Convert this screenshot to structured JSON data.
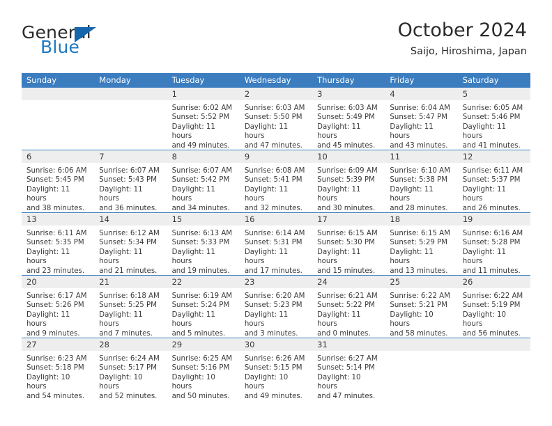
{
  "brand": {
    "name_top": "General",
    "name_bottom": "Blue",
    "triangle_icon": "triangle-icon",
    "color_top": "#2b2b2b",
    "color_bottom": "#1f79c0",
    "triangle_color": "#1566ad"
  },
  "header": {
    "title": "October 2024",
    "subtitle": "Saijo, Hiroshima, Japan"
  },
  "theme": {
    "header_band": "#3b7dbf",
    "date_band": "#eeeeee",
    "text": "#3a3a3a"
  },
  "weekdays": [
    "Sunday",
    "Monday",
    "Tuesday",
    "Wednesday",
    "Thursday",
    "Friday",
    "Saturday"
  ],
  "weeks": [
    [
      {
        "day": "",
        "info": ""
      },
      {
        "day": "",
        "info": ""
      },
      {
        "day": "1",
        "info": "Sunrise: 6:02 AM\nSunset: 5:52 PM\nDaylight: 11 hours\nand 49 minutes."
      },
      {
        "day": "2",
        "info": "Sunrise: 6:03 AM\nSunset: 5:50 PM\nDaylight: 11 hours\nand 47 minutes."
      },
      {
        "day": "3",
        "info": "Sunrise: 6:03 AM\nSunset: 5:49 PM\nDaylight: 11 hours\nand 45 minutes."
      },
      {
        "day": "4",
        "info": "Sunrise: 6:04 AM\nSunset: 5:47 PM\nDaylight: 11 hours\nand 43 minutes."
      },
      {
        "day": "5",
        "info": "Sunrise: 6:05 AM\nSunset: 5:46 PM\nDaylight: 11 hours\nand 41 minutes."
      }
    ],
    [
      {
        "day": "6",
        "info": "Sunrise: 6:06 AM\nSunset: 5:45 PM\nDaylight: 11 hours\nand 38 minutes."
      },
      {
        "day": "7",
        "info": "Sunrise: 6:07 AM\nSunset: 5:43 PM\nDaylight: 11 hours\nand 36 minutes."
      },
      {
        "day": "8",
        "info": "Sunrise: 6:07 AM\nSunset: 5:42 PM\nDaylight: 11 hours\nand 34 minutes."
      },
      {
        "day": "9",
        "info": "Sunrise: 6:08 AM\nSunset: 5:41 PM\nDaylight: 11 hours\nand 32 minutes."
      },
      {
        "day": "10",
        "info": "Sunrise: 6:09 AM\nSunset: 5:39 PM\nDaylight: 11 hours\nand 30 minutes."
      },
      {
        "day": "11",
        "info": "Sunrise: 6:10 AM\nSunset: 5:38 PM\nDaylight: 11 hours\nand 28 minutes."
      },
      {
        "day": "12",
        "info": "Sunrise: 6:11 AM\nSunset: 5:37 PM\nDaylight: 11 hours\nand 26 minutes."
      }
    ],
    [
      {
        "day": "13",
        "info": "Sunrise: 6:11 AM\nSunset: 5:35 PM\nDaylight: 11 hours\nand 23 minutes."
      },
      {
        "day": "14",
        "info": "Sunrise: 6:12 AM\nSunset: 5:34 PM\nDaylight: 11 hours\nand 21 minutes."
      },
      {
        "day": "15",
        "info": "Sunrise: 6:13 AM\nSunset: 5:33 PM\nDaylight: 11 hours\nand 19 minutes."
      },
      {
        "day": "16",
        "info": "Sunrise: 6:14 AM\nSunset: 5:31 PM\nDaylight: 11 hours\nand 17 minutes."
      },
      {
        "day": "17",
        "info": "Sunrise: 6:15 AM\nSunset: 5:30 PM\nDaylight: 11 hours\nand 15 minutes."
      },
      {
        "day": "18",
        "info": "Sunrise: 6:15 AM\nSunset: 5:29 PM\nDaylight: 11 hours\nand 13 minutes."
      },
      {
        "day": "19",
        "info": "Sunrise: 6:16 AM\nSunset: 5:28 PM\nDaylight: 11 hours\nand 11 minutes."
      }
    ],
    [
      {
        "day": "20",
        "info": "Sunrise: 6:17 AM\nSunset: 5:26 PM\nDaylight: 11 hours\nand 9 minutes."
      },
      {
        "day": "21",
        "info": "Sunrise: 6:18 AM\nSunset: 5:25 PM\nDaylight: 11 hours\nand 7 minutes."
      },
      {
        "day": "22",
        "info": "Sunrise: 6:19 AM\nSunset: 5:24 PM\nDaylight: 11 hours\nand 5 minutes."
      },
      {
        "day": "23",
        "info": "Sunrise: 6:20 AM\nSunset: 5:23 PM\nDaylight: 11 hours\nand 3 minutes."
      },
      {
        "day": "24",
        "info": "Sunrise: 6:21 AM\nSunset: 5:22 PM\nDaylight: 11 hours\nand 0 minutes."
      },
      {
        "day": "25",
        "info": "Sunrise: 6:22 AM\nSunset: 5:21 PM\nDaylight: 10 hours\nand 58 minutes."
      },
      {
        "day": "26",
        "info": "Sunrise: 6:22 AM\nSunset: 5:19 PM\nDaylight: 10 hours\nand 56 minutes."
      }
    ],
    [
      {
        "day": "27",
        "info": "Sunrise: 6:23 AM\nSunset: 5:18 PM\nDaylight: 10 hours\nand 54 minutes."
      },
      {
        "day": "28",
        "info": "Sunrise: 6:24 AM\nSunset: 5:17 PM\nDaylight: 10 hours\nand 52 minutes."
      },
      {
        "day": "29",
        "info": "Sunrise: 6:25 AM\nSunset: 5:16 PM\nDaylight: 10 hours\nand 50 minutes."
      },
      {
        "day": "30",
        "info": "Sunrise: 6:26 AM\nSunset: 5:15 PM\nDaylight: 10 hours\nand 49 minutes."
      },
      {
        "day": "31",
        "info": "Sunrise: 6:27 AM\nSunset: 5:14 PM\nDaylight: 10 hours\nand 47 minutes."
      },
      {
        "day": "",
        "info": ""
      },
      {
        "day": "",
        "info": ""
      }
    ]
  ]
}
